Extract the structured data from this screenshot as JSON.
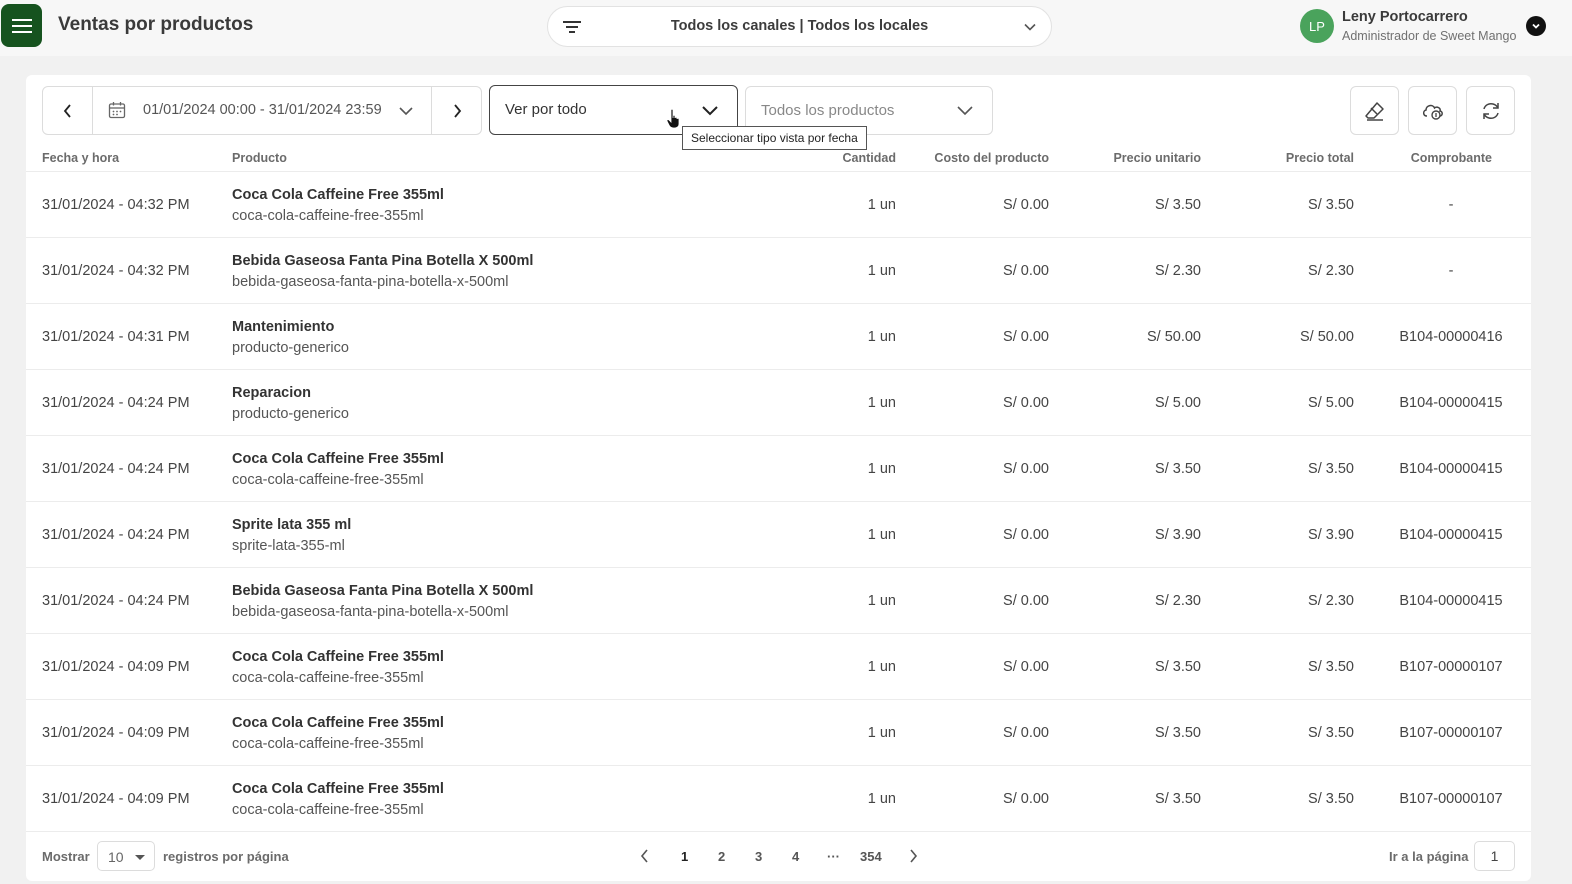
{
  "header": {
    "title": "Ventas por productos",
    "channel_filter": "Todos los canales | Todos los locales",
    "user": {
      "initials": "LP",
      "name": "Leny Portocarrero",
      "role": "Administrador de Sweet Mango"
    }
  },
  "filters": {
    "date_range": "01/01/2024 00:00 - 31/01/2024 23:59",
    "view_mode": "Ver por todo",
    "product": "Todos los productos",
    "tooltip": "Seleccionar tipo vista por fecha"
  },
  "table": {
    "columns": [
      "Fecha y hora",
      "Producto",
      "Cantidad",
      "Costo del producto",
      "Precio unitario",
      "Precio total",
      "Comprobante"
    ],
    "rows": [
      {
        "date": "31/01/2024 - 04:32 PM",
        "name": "Coca Cola Caffeine Free 355ml",
        "slug": "coca-cola-caffeine-free-355ml",
        "qty": "1 un",
        "cost": "S/ 0.00",
        "unit": "S/ 3.50",
        "total": "S/ 3.50",
        "receipt": "-"
      },
      {
        "date": "31/01/2024 - 04:32 PM",
        "name": "Bebida Gaseosa Fanta Pina Botella X 500ml",
        "slug": "bebida-gaseosa-fanta-pina-botella-x-500ml",
        "qty": "1 un",
        "cost": "S/ 0.00",
        "unit": "S/ 2.30",
        "total": "S/ 2.30",
        "receipt": "-"
      },
      {
        "date": "31/01/2024 - 04:31 PM",
        "name": "Mantenimiento",
        "slug": "producto-generico",
        "qty": "1 un",
        "cost": "S/ 0.00",
        "unit": "S/ 50.00",
        "total": "S/ 50.00",
        "receipt": "B104-00000416"
      },
      {
        "date": "31/01/2024 - 04:24 PM",
        "name": "Reparacion",
        "slug": "producto-generico",
        "qty": "1 un",
        "cost": "S/ 0.00",
        "unit": "S/ 5.00",
        "total": "S/ 5.00",
        "receipt": "B104-00000415"
      },
      {
        "date": "31/01/2024 - 04:24 PM",
        "name": "Coca Cola Caffeine Free 355ml",
        "slug": "coca-cola-caffeine-free-355ml",
        "qty": "1 un",
        "cost": "S/ 0.00",
        "unit": "S/ 3.50",
        "total": "S/ 3.50",
        "receipt": "B104-00000415"
      },
      {
        "date": "31/01/2024 - 04:24 PM",
        "name": "Sprite lata 355 ml",
        "slug": "sprite-lata-355-ml",
        "qty": "1 un",
        "cost": "S/ 0.00",
        "unit": "S/ 3.90",
        "total": "S/ 3.90",
        "receipt": "B104-00000415"
      },
      {
        "date": "31/01/2024 - 04:24 PM",
        "name": "Bebida Gaseosa Fanta Pina Botella X 500ml",
        "slug": "bebida-gaseosa-fanta-pina-botella-x-500ml",
        "qty": "1 un",
        "cost": "S/ 0.00",
        "unit": "S/ 2.30",
        "total": "S/ 2.30",
        "receipt": "B104-00000415"
      },
      {
        "date": "31/01/2024 - 04:09 PM",
        "name": "Coca Cola Caffeine Free 355ml",
        "slug": "coca-cola-caffeine-free-355ml",
        "qty": "1 un",
        "cost": "S/ 0.00",
        "unit": "S/ 3.50",
        "total": "S/ 3.50",
        "receipt": "B107-00000107"
      },
      {
        "date": "31/01/2024 - 04:09 PM",
        "name": "Coca Cola Caffeine Free 355ml",
        "slug": "coca-cola-caffeine-free-355ml",
        "qty": "1 un",
        "cost": "S/ 0.00",
        "unit": "S/ 3.50",
        "total": "S/ 3.50",
        "receipt": "B107-00000107"
      },
      {
        "date": "31/01/2024 - 04:09 PM",
        "name": "Coca Cola Caffeine Free 355ml",
        "slug": "coca-cola-caffeine-free-355ml",
        "qty": "1 un",
        "cost": "S/ 0.00",
        "unit": "S/ 3.50",
        "total": "S/ 3.50",
        "receipt": "B107-00000107"
      }
    ]
  },
  "footer": {
    "show_label": "Mostrar",
    "per_page": "10",
    "per_page_label": "registros por página",
    "pages": [
      "1",
      "2",
      "3",
      "4",
      "···",
      "354"
    ],
    "current_page": "1",
    "goto_label": "Ir a la página",
    "goto_value": "1"
  },
  "colors": {
    "brand": "#16531f",
    "avatar": "#4aa35c"
  }
}
